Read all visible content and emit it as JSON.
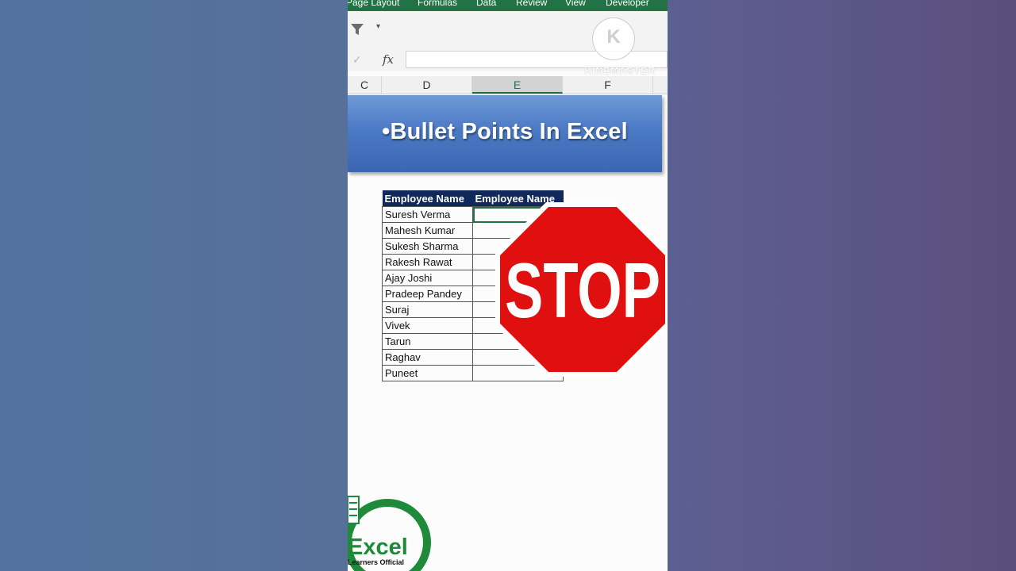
{
  "ribbon": {
    "tabs": [
      "Page Layout",
      "Formulas",
      "Data",
      "Review",
      "View",
      "Developer"
    ]
  },
  "toolbar": {
    "filter_icon": "filter-icon",
    "qat_dropdown": "▾"
  },
  "formula_bar": {
    "check": "✓",
    "fx": "fx",
    "value": ""
  },
  "columns": [
    "C",
    "D",
    "E",
    "F"
  ],
  "selected_column": "E",
  "banner": {
    "title": "•Bullet Points In Excel"
  },
  "table": {
    "headers": [
      "Employee Name",
      "Employee Name"
    ],
    "rows": [
      [
        "Suresh Verma",
        ""
      ],
      [
        "Mahesh Kumar",
        ""
      ],
      [
        "Sukesh Sharma",
        ""
      ],
      [
        "Rakesh Rawat",
        ""
      ],
      [
        "Ajay Joshi",
        ""
      ],
      [
        "Pradeep Pandey",
        ""
      ],
      [
        "Suraj",
        ""
      ],
      [
        "Vivek",
        ""
      ],
      [
        "Tarun",
        ""
      ],
      [
        "Raghav",
        ""
      ],
      [
        "Puneet",
        ""
      ]
    ]
  },
  "stop_sign": {
    "text": "STOP",
    "color": "#e01010"
  },
  "watermark": {
    "letter": "K",
    "text": "KINEMASTER"
  },
  "logo": {
    "word": "Excel",
    "subtitle": "Learners Official",
    "color": "#1f8a3a"
  },
  "colors": {
    "excel_green": "#217346",
    "header_navy": "#10285a",
    "banner_blue": "#4b79c4"
  }
}
